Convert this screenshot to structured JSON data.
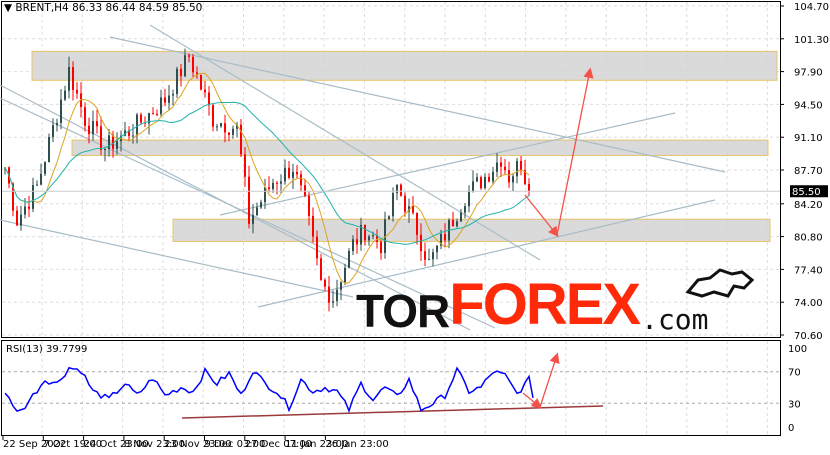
{
  "header": {
    "symbol": "BRENT,H4",
    "ohlc": "86.33 86.44 84.59 85.50"
  },
  "logo": {
    "part1": "TOR",
    "part2": "FOREX",
    "part3": ".com"
  },
  "colors": {
    "bull": "#2f4f4f",
    "bear": "#ff0000",
    "ma_fast": "#daa520",
    "ma_slow": "#20b2aa",
    "zone": "#d3d3d3",
    "zone_border": "#e8c36a",
    "trend": "#a8bcc8",
    "arrow": "#f4514b",
    "rsi": "#0000ff",
    "rsi_support": "#9b3a3a"
  },
  "chart_data": [
    {
      "type": "candlestick",
      "title": "BRENT,H4",
      "ylim": [
        70.6,
        104.7
      ],
      "y_ticks": [
        "104.70",
        "101.30",
        "97.90",
        "94.50",
        "91.10",
        "87.70",
        "84.20",
        "80.80",
        "77.40",
        "74.00",
        "70.60"
      ],
      "last_price": "85.50",
      "price_path": [
        [
          0,
          88
        ],
        [
          3,
          82.5
        ],
        [
          8,
          86
        ],
        [
          16,
          98
        ],
        [
          20,
          93
        ],
        [
          25,
          90
        ],
        [
          32,
          92
        ],
        [
          40,
          95
        ],
        [
          46,
          99.5
        ],
        [
          52,
          93
        ],
        [
          58,
          92
        ],
        [
          60,
          86
        ],
        [
          61,
          82.5
        ],
        [
          67,
          86.5
        ],
        [
          72,
          88
        ],
        [
          75,
          84
        ],
        [
          79,
          76
        ],
        [
          82,
          74.5
        ],
        [
          87,
          80
        ],
        [
          90,
          81.5
        ],
        [
          94,
          80
        ],
        [
          98,
          86
        ],
        [
          103,
          81.5
        ],
        [
          106,
          78
        ],
        [
          110,
          81
        ],
        [
          115,
          85
        ],
        [
          120,
          87
        ],
        [
          124,
          89
        ],
        [
          126,
          87
        ],
        [
          129,
          88.5
        ],
        [
          131,
          85.5
        ]
      ],
      "zones": [
        [
          97.0,
          100.0
        ],
        [
          89.2,
          90.8
        ],
        [
          80.3,
          82.6
        ]
      ],
      "x_labels": [
        "22 Sep 2022",
        "7 Oct 19:00",
        "24 Oct 23:00",
        "8 Nov 23:00",
        "23 Nov 23:00",
        "9 Dec 03:00",
        "27 Dec 07:00",
        "11 Jan 23:00",
        "26 Jan 23:00"
      ]
    },
    {
      "type": "line",
      "title": "RSI(13) 39.7799",
      "ylim": [
        0,
        100
      ],
      "y_ticks": [
        "100",
        "70",
        "30",
        "0"
      ],
      "levels": [
        70,
        30
      ],
      "rsi_path": [
        [
          0,
          45
        ],
        [
          2,
          25
        ],
        [
          4,
          20
        ],
        [
          7,
          40
        ],
        [
          10,
          60
        ],
        [
          13,
          55
        ],
        [
          16,
          75
        ],
        [
          19,
          72
        ],
        [
          22,
          45
        ],
        [
          26,
          35
        ],
        [
          30,
          55
        ],
        [
          33,
          40
        ],
        [
          37,
          62
        ],
        [
          40,
          40
        ],
        [
          44,
          50
        ],
        [
          47,
          45
        ],
        [
          50,
          70
        ],
        [
          53,
          55
        ],
        [
          56,
          68
        ],
        [
          59,
          40
        ],
        [
          62,
          72
        ],
        [
          65,
          55
        ],
        [
          68,
          45
        ],
        [
          71,
          25
        ],
        [
          74,
          60
        ],
        [
          77,
          45
        ],
        [
          80,
          50
        ],
        [
          83,
          45
        ],
        [
          86,
          22
        ],
        [
          89,
          55
        ],
        [
          92,
          35
        ],
        [
          95,
          50
        ],
        [
          98,
          38
        ],
        [
          101,
          60
        ],
        [
          104,
          22
        ],
        [
          107,
          30
        ],
        [
          110,
          40
        ],
        [
          113,
          72
        ],
        [
          116,
          45
        ],
        [
          119,
          50
        ],
        [
          122,
          70
        ],
        [
          125,
          65
        ],
        [
          128,
          42
        ],
        [
          131,
          60
        ],
        [
          132,
          40
        ]
      ]
    }
  ]
}
